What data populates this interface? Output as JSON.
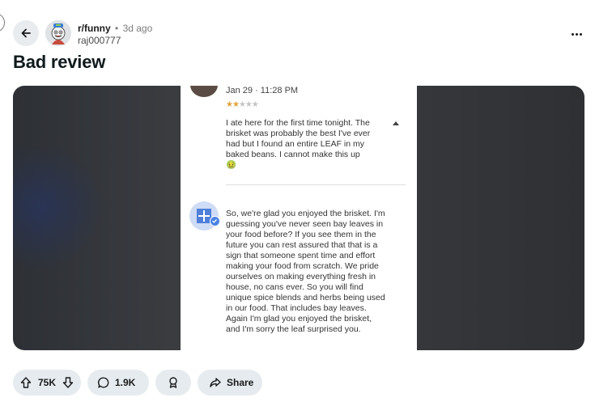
{
  "header": {
    "subreddit": "r/funny",
    "separator": "•",
    "time_ago": "3d ago",
    "author": "raj000777"
  },
  "post": {
    "title": "Bad review"
  },
  "screenshot": {
    "review_date": "Jan 29 · 11:28 PM",
    "rating": 2,
    "rating_max": 5,
    "review_text": "I ate here for the first time tonight. The brisket was probably the best I've ever had but I found an entire LEAF in my baked beans. I cannot make this up 🤢",
    "reply_text": "So, we're glad you enjoyed the brisket. I'm guessing you've never seen bay leaves in your food before? If you see them in the future you can rest assured that that is a sign that someone spent time and effort making your food from scratch. We pride ourselves on making everything fresh in house, no cans ever. So you will find unique spice blends and herbs being used in our food. That includes bay leaves. Again I'm glad you enjoyed the brisket, and I'm sorry the leaf surprised you."
  },
  "actions": {
    "votes": "75K",
    "comments": "1.9K",
    "share_label": "Share"
  },
  "icons": {
    "back": "arrow-left-icon",
    "more": "more-horizontal-icon",
    "upvote": "upvote-icon",
    "downvote": "downvote-icon",
    "comment": "comment-icon",
    "award": "award-icon",
    "share": "share-icon"
  }
}
